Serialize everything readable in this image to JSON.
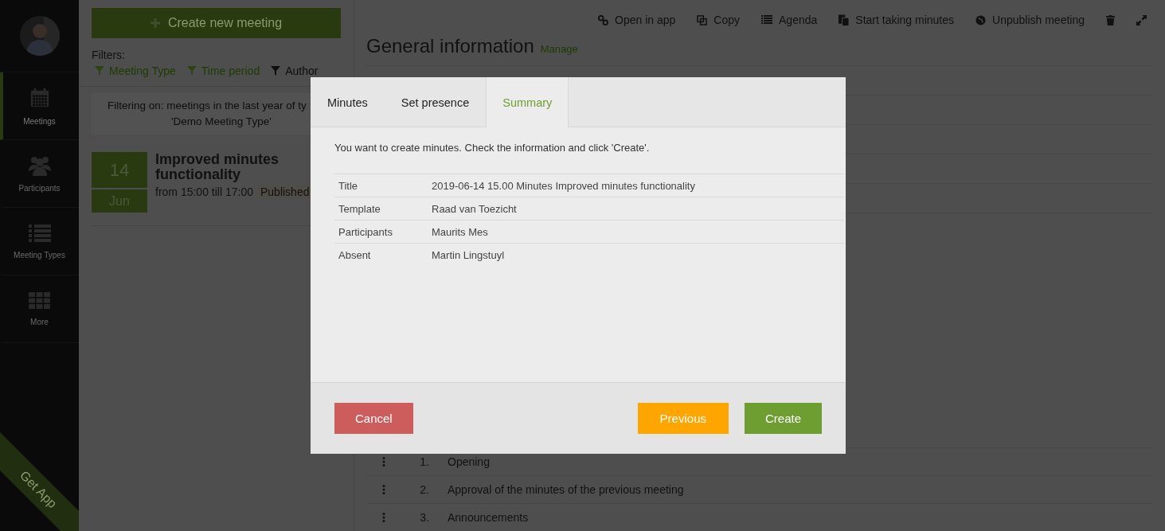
{
  "sidebar": {
    "items": [
      {
        "label": "Meetings",
        "selected": true
      },
      {
        "label": "Participants",
        "selected": false
      },
      {
        "label": "Meeting Types",
        "selected": false
      },
      {
        "label": "More",
        "selected": false
      }
    ],
    "ribbon": "Get App"
  },
  "meetings": {
    "create_button": "Create new meeting",
    "filters_label": "Filters:",
    "filters": [
      {
        "label": "Meeting Type",
        "active": true
      },
      {
        "label": "Time period",
        "active": true
      },
      {
        "label": "Author",
        "active": false
      }
    ],
    "filter_notice": [
      "Filtering on: meetings in the last year of ty",
      "'Demo Meeting Type'"
    ],
    "items": [
      {
        "day": "14",
        "month": "Jun",
        "title": "Improved minutes functionality",
        "time": "from 15:00 till 17:00",
        "status": "Published"
      }
    ]
  },
  "toolbar": [
    "Open in app",
    "Copy",
    "Agenda",
    "Start taking minutes",
    "Unpublish meeting"
  ],
  "general": {
    "title": "General information",
    "manage_link": "Manage"
  },
  "agenda": [
    {
      "number": "1.",
      "title": "Opening"
    },
    {
      "number": "2.",
      "title": "Approval of the minutes of the previous meeting"
    },
    {
      "number": "3.",
      "title": "Announcements"
    }
  ],
  "dialog": {
    "tabs": [
      {
        "label": "Minutes",
        "selected": false
      },
      {
        "label": "Set presence",
        "selected": false
      },
      {
        "label": "Summary",
        "selected": true
      }
    ],
    "intro": "You want to create minutes. Check the information and click 'Create'.",
    "summary": [
      {
        "label": "Title",
        "value": "2019-06-14 15.00 Minutes Improved minutes functionality"
      },
      {
        "label": "Template",
        "value": "Raad van Toezicht"
      },
      {
        "label": "Participants",
        "value": "Maurits Mes"
      },
      {
        "label": "Absent",
        "value": "Martin Lingstuyl"
      }
    ],
    "buttons": [
      {
        "label": "Cancel",
        "kind": "danger"
      },
      {
        "label": "Previous",
        "kind": "warning"
      },
      {
        "label": "Create",
        "kind": "primary"
      }
    ]
  }
}
